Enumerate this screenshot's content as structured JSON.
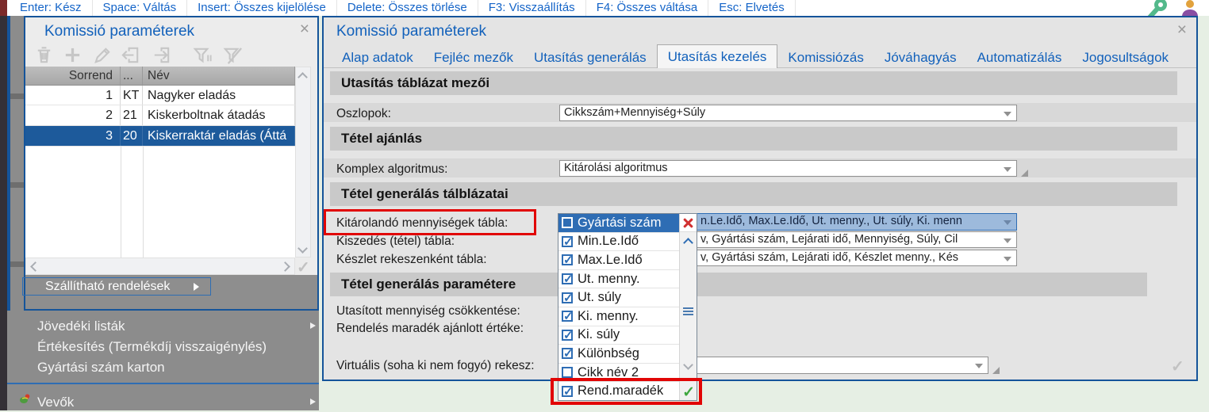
{
  "colors": {
    "accent_blue": "#1261bb",
    "window_border": "#15549a",
    "selection_blue": "#1d5a9b",
    "dropdown_blue": "#2e6db4",
    "annotation_red": "#e10505",
    "menu_gray": "#8c8c8c",
    "background_green": "#e6efe4"
  },
  "top_bar": {
    "hints": [
      {
        "label": "Enter: Kész"
      },
      {
        "label": "Space: Váltás"
      },
      {
        "label": "Insert: Összes kijelölése"
      },
      {
        "label": "Delete: Összes törlése"
      },
      {
        "label": "F3: Visszaállítás"
      },
      {
        "label": "F4: Összes váltása"
      },
      {
        "label": "Esc: Elvetés"
      }
    ]
  },
  "left_window": {
    "title": "Komissió paraméterek",
    "close_glyph": "×",
    "toolbar_icons": [
      "delete-icon",
      "add-icon",
      "edit-icon",
      "move-in-icon",
      "move-out-icon",
      "filter-icon",
      "clear-filter-icon"
    ],
    "table": {
      "columns": {
        "c1": "Sorrend",
        "c2": "...",
        "c3": "Név"
      },
      "rows": [
        {
          "sorrend": "1",
          "tipus": "KT",
          "nev": "Nagyker eladás",
          "selected": false
        },
        {
          "sorrend": "2",
          "tipus": "21",
          "nev": "Kiskerboltnak átadás",
          "selected": false
        },
        {
          "sorrend": "3",
          "tipus": "20",
          "nev": "Kiskerraktár eladás (Áttá",
          "selected": true
        }
      ]
    },
    "footer_button": {
      "label": "Szállítható rendelések"
    }
  },
  "left_menu": {
    "items": [
      {
        "label": "Jövedéki listák",
        "has_arrow": true
      },
      {
        "label": "Értékesítés (Termékdíj visszaigénylés)",
        "has_arrow": false
      },
      {
        "label": "Gyártási szám karton",
        "has_arrow": false
      }
    ],
    "bottom_item": {
      "label": "Vevők"
    }
  },
  "right_window": {
    "title": "Komissió paraméterek",
    "close_glyph": "×",
    "tabs": [
      {
        "label": "Alap adatok",
        "active": false
      },
      {
        "label": "Fejléc mezők",
        "active": false
      },
      {
        "label": "Utasítás generálás",
        "active": false
      },
      {
        "label": "Utasítás kezelés",
        "active": true
      },
      {
        "label": "Komissiózás",
        "active": false
      },
      {
        "label": "Jóváhagyás",
        "active": false
      },
      {
        "label": "Automatizálás",
        "active": false
      },
      {
        "label": "Jogosultságok",
        "active": false
      }
    ],
    "sections": {
      "s1": "Utasítás táblázat mezői",
      "s2": "Tétel ajánlás",
      "s3": "Tétel generálás tálblázatai",
      "s4": "Tétel generálás paramétere"
    },
    "fields": {
      "oszlopok": {
        "label": "Oszlopok:",
        "value": "Cikkszám+Mennyiség+Súly"
      },
      "komplex": {
        "label": "Komplex algoritmus:",
        "value": "Kitárolási algoritmus"
      },
      "kitarolando": {
        "label": "Kitárolandó mennyiségek tábla:",
        "value_visible": "n.Le.Idő, Max.Le.Idő, Ut. menny., Ut. súly, Ki. menn"
      },
      "kiszedes": {
        "label": "Kiszedés (tétel) tábla:",
        "value_visible": "v, Gyártási szám, Lejárati idő, Mennyiség, Súly, Cil"
      },
      "keszlet": {
        "label": "Készlet rekeszenként tábla:",
        "value_visible": "v, Gyártási szám, Lejárati idő, Készlet menny., Kés"
      },
      "utasitott": {
        "label": "Utasított mennyiség csökkentése:"
      },
      "rendeles": {
        "label": "Rendelés maradék ajánlott értéke:"
      },
      "virtualis": {
        "label": "Virtuális (soha ki nem fogyó) rekesz:",
        "value": ""
      }
    }
  },
  "dropdown": {
    "items": [
      {
        "label": "Gyártási szám",
        "checked": false,
        "selected": true
      },
      {
        "label": "Min.Le.Idő",
        "checked": true,
        "selected": false
      },
      {
        "label": "Max.Le.Idő",
        "checked": true,
        "selected": false
      },
      {
        "label": "Ut. menny.",
        "checked": true,
        "selected": false
      },
      {
        "label": "Ut. súly",
        "checked": true,
        "selected": false
      },
      {
        "label": "Ki. menny.",
        "checked": true,
        "selected": false
      },
      {
        "label": "Ki. súly",
        "checked": true,
        "selected": false
      },
      {
        "label": "Különbség",
        "checked": true,
        "selected": false
      },
      {
        "label": "Cikk név 2",
        "checked": false,
        "selected": false
      },
      {
        "label": "Rend.maradék",
        "checked": true,
        "selected": false
      }
    ]
  }
}
